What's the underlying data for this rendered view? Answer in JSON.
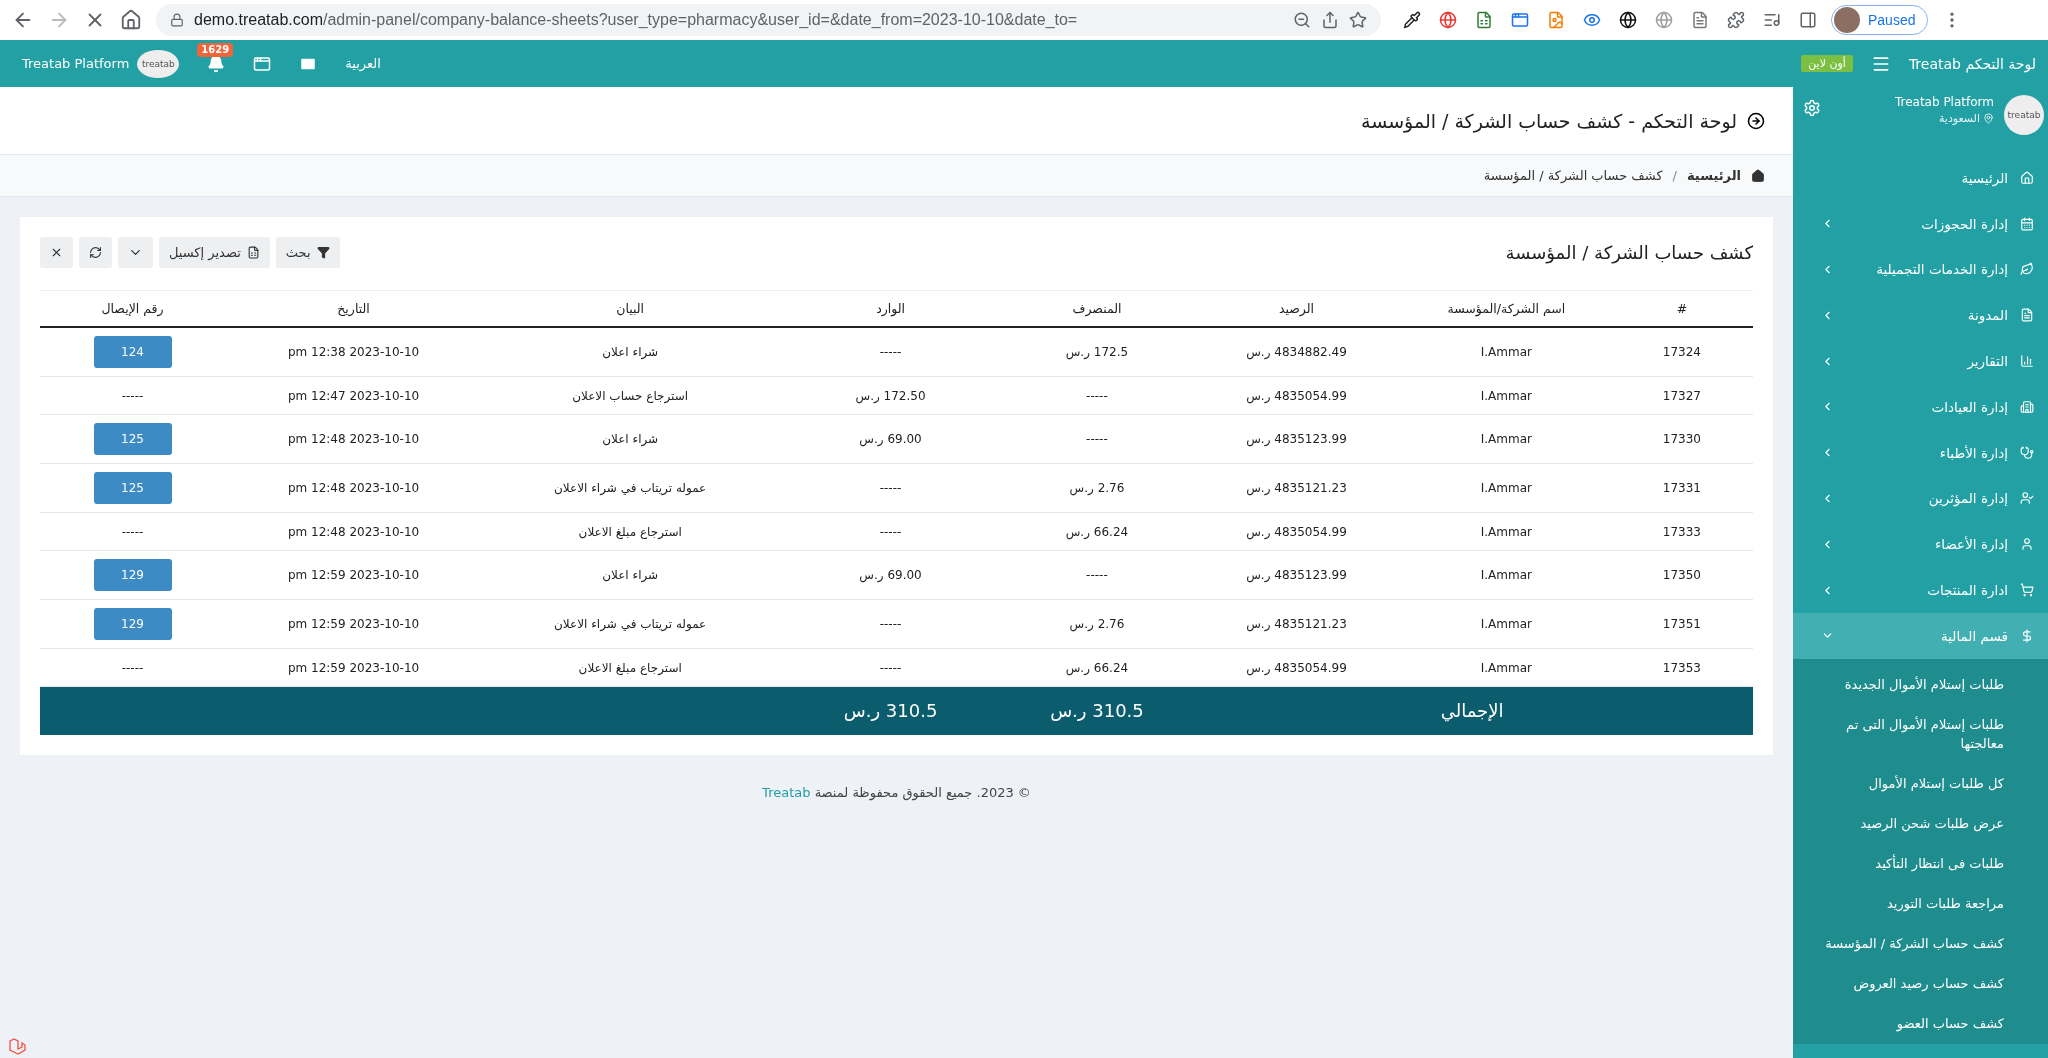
{
  "browser": {
    "url_host": "demo.treatab.com",
    "url_path": "/admin-panel/company-balance-sheets?user_type=pharmacy&user_id=&date_from=2023-10-10&date_to=",
    "profile": "Paused"
  },
  "header": {
    "brand": "لوحة التحكم Treatab",
    "status": "أون لاين",
    "language": "العربية",
    "notifications": "1629",
    "platform": "Treatab Platform",
    "logo": "treatab"
  },
  "sidebar": {
    "platform": "Treatab Platform",
    "country": "السعودية",
    "logo": "treatab",
    "items": [
      {
        "label": "الرئيسية",
        "kind": "link"
      },
      {
        "label": "إدارة الحجوزات",
        "kind": "group",
        "expanded": false
      },
      {
        "label": "إدارة الخدمات التجميلية",
        "kind": "group",
        "expanded": false
      },
      {
        "label": "المدونة",
        "kind": "group",
        "expanded": false
      },
      {
        "label": "التقارير",
        "kind": "group",
        "expanded": false
      },
      {
        "label": "إدارة العيادات",
        "kind": "group",
        "expanded": false
      },
      {
        "label": "إدارة الأطباء",
        "kind": "group",
        "expanded": false
      },
      {
        "label": "إدارة المؤثرين",
        "kind": "group",
        "expanded": false
      },
      {
        "label": "إدارة الأعضاء",
        "kind": "group",
        "expanded": false
      },
      {
        "label": "ادارة المنتجات",
        "kind": "group",
        "expanded": false
      },
      {
        "label": "قسم المالية",
        "kind": "group",
        "expanded": true,
        "children": [
          {
            "label": "طلبات إستلام الأموال الجديدة"
          },
          {
            "label": "طلبات إستلام الأموال التى تم معالجتها"
          },
          {
            "label": "كل طلبات إستلام الأموال"
          },
          {
            "label": "عرض طلبات شحن الرصيد"
          },
          {
            "label": "طلبات فى انتظار التأكيد"
          },
          {
            "label": "مراجعة طلبات التوريد"
          },
          {
            "label": "كشف حساب الشركة / المؤسسة"
          },
          {
            "label": "كشف حساب رصيد العروض"
          },
          {
            "label": "كشف حساب العضو"
          }
        ]
      }
    ]
  },
  "page_title": "لوحة التحكم - كشف حساب الشركة / المؤسسة",
  "breadcrumb": {
    "separator": "/",
    "items": [
      "الرئيسية",
      "كشف حساب الشركة / المؤسسة"
    ]
  },
  "card": {
    "title": "كشف حساب الشركة / المؤسسة",
    "buttons": {
      "search": "بحث",
      "export": "تصدير إكسيل"
    }
  },
  "table": {
    "columns": [
      "#",
      "اسم الشركة/المؤسسة",
      "الرصيد",
      "المنصرف",
      "الوارد",
      "البيان",
      "التاريخ",
      "رقم الإيصال"
    ],
    "rows": [
      {
        "id": "17324",
        "company": "I.Ammar",
        "balance": "4834882.49 ر.س",
        "expense": "172.5 ر.س",
        "income": "-----",
        "statement": "شراء اعلان",
        "date": "2023-10-10 12:38 pm",
        "receipt": {
          "kind": "button",
          "label": "124"
        }
      },
      {
        "id": "17327",
        "company": "I.Ammar",
        "balance": "4835054.99 ر.س",
        "expense": "-----",
        "income": "172.50 ر.س",
        "statement": "استرجاع حساب الاعلان",
        "date": "2023-10-10 12:47 pm",
        "receipt": {
          "kind": "text",
          "label": "-----"
        }
      },
      {
        "id": "17330",
        "company": "I.Ammar",
        "balance": "4835123.99 ر.س",
        "expense": "-----",
        "income": "69.00 ر.س",
        "statement": "شراء اعلان",
        "date": "2023-10-10 12:48 pm",
        "receipt": {
          "kind": "button",
          "label": "125"
        }
      },
      {
        "id": "17331",
        "company": "I.Ammar",
        "balance": "4835121.23 ر.س",
        "expense": "2.76 ر.س",
        "income": "-----",
        "statement": "عموله تريتاب في شراء الاعلان",
        "date": "2023-10-10 12:48 pm",
        "receipt": {
          "kind": "button",
          "label": "125"
        }
      },
      {
        "id": "17333",
        "company": "I.Ammar",
        "balance": "4835054.99 ر.س",
        "expense": "66.24 ر.س",
        "income": "-----",
        "statement": "استرجاع مبلغ الاعلان",
        "date": "2023-10-10 12:48 pm",
        "receipt": {
          "kind": "text",
          "label": "-----"
        }
      },
      {
        "id": "17350",
        "company": "I.Ammar",
        "balance": "4835123.99 ر.س",
        "expense": "-----",
        "income": "69.00 ر.س",
        "statement": "شراء اعلان",
        "date": "2023-10-10 12:59 pm",
        "receipt": {
          "kind": "button",
          "label": "129"
        }
      },
      {
        "id": "17351",
        "company": "I.Ammar",
        "balance": "4835121.23 ر.س",
        "expense": "2.76 ر.س",
        "income": "-----",
        "statement": "عموله تريتاب في شراء الاعلان",
        "date": "2023-10-10 12:59 pm",
        "receipt": {
          "kind": "button",
          "label": "129"
        }
      },
      {
        "id": "17353",
        "company": "I.Ammar",
        "balance": "4835054.99 ر.س",
        "expense": "66.24 ر.س",
        "income": "-----",
        "statement": "استرجاع مبلغ الاعلان",
        "date": "2023-10-10 12:59 pm",
        "receipt": {
          "kind": "text",
          "label": "-----"
        }
      }
    ],
    "total": {
      "label": "الإجمالي",
      "expense": "310.5 ر.س",
      "income": "310.5 ر.س"
    }
  },
  "footer": {
    "text": "© 2023. جميع الحقوق محفوظة لمنصة",
    "link": "Treatab"
  }
}
